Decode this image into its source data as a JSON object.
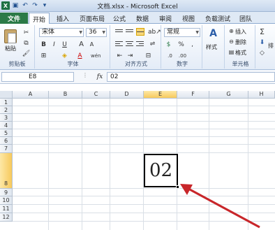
{
  "window": {
    "title": "文档.xlsx - Microsoft Excel",
    "app_icon_letter": "X"
  },
  "quick_access": [
    {
      "icon": "save-icon",
      "glyph": "💾"
    },
    {
      "icon": "undo-icon",
      "glyph": "↶"
    },
    {
      "icon": "redo-icon",
      "glyph": "↷"
    },
    {
      "icon": "customize-icon",
      "glyph": "▾"
    }
  ],
  "tabs": [
    "文件",
    "开始",
    "插入",
    "页面布局",
    "公式",
    "数据",
    "审阅",
    "视图",
    "负载测试",
    "团队"
  ],
  "active_tab": "开始",
  "ribbon": {
    "clipboard": {
      "label": "剪贴板",
      "paste": "粘贴"
    },
    "font": {
      "label": "字体",
      "font_name": "宋体",
      "font_size": "36",
      "bold": "B",
      "italic": "I",
      "underline": "U",
      "grow": "A",
      "shrink": "A",
      "font_color": "A",
      "wen": "wén"
    },
    "alignment": {
      "label": "对齐方式"
    },
    "number": {
      "label": "数字",
      "format": "常规",
      "currency": "$",
      "percent": "%",
      "comma": ","
    },
    "styles": {
      "label": "样式",
      "button": "样式"
    },
    "cells": {
      "label": "单元格",
      "insert": "插入",
      "delete": "删除",
      "format": "格式"
    },
    "editing": {
      "sigma": "Σ",
      "sort": "排"
    }
  },
  "formula_bar": {
    "name_box": "E8",
    "fx": "fx",
    "content": "02"
  },
  "columns": [
    "A",
    "B",
    "C",
    "D",
    "E",
    "F",
    "G",
    "H"
  ],
  "rows": [
    "1",
    "2",
    "3",
    "4",
    "5",
    "6",
    "7",
    "8",
    "9",
    "10",
    "11",
    "12"
  ],
  "selected": {
    "column": "E",
    "row": "8"
  },
  "cell_value": "02",
  "colors": {
    "accent": "#2b7a47",
    "selection_header": "#f7c95c",
    "arrow": "#c8262a"
  }
}
